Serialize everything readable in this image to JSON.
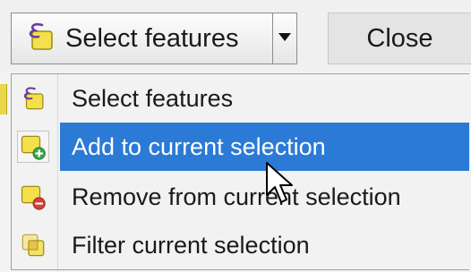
{
  "toolbar": {
    "select_button_label": "Select features",
    "close_label": "Close"
  },
  "menu": {
    "items": [
      {
        "label": "Select features",
        "icon": "select-features-icon"
      },
      {
        "label": "Add to current selection",
        "icon": "add-selection-icon"
      },
      {
        "label": "Remove from current selection",
        "icon": "remove-selection-icon"
      },
      {
        "label": "Filter current selection",
        "icon": "filter-selection-icon"
      }
    ],
    "selected_index": 1
  },
  "colors": {
    "highlight": "#2b7ad6",
    "feature_yellow": "#f3e04a",
    "add_green": "#3aa64a",
    "remove_red": "#d6403a",
    "select_purple": "#6a3fa0"
  }
}
